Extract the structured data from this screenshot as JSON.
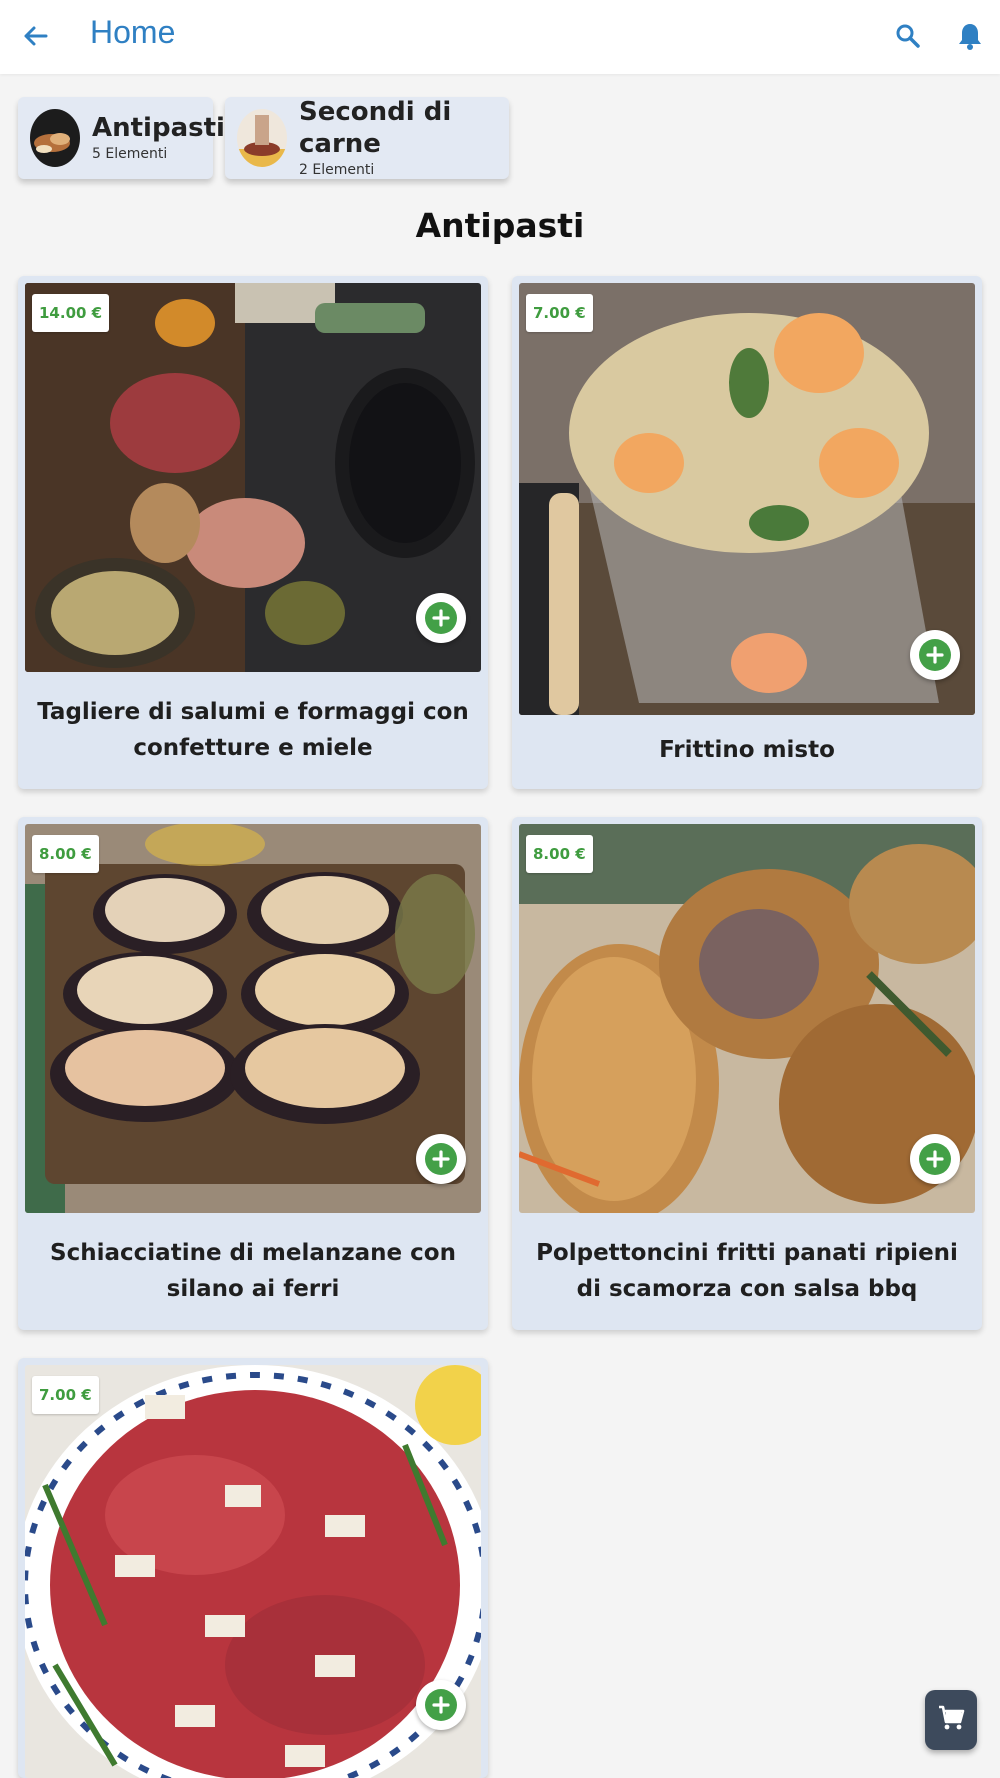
{
  "appbar": {
    "title": "Home",
    "back_icon": "arrow-left-icon",
    "search_icon": "search-icon",
    "notification_icon": "bell-icon"
  },
  "categories": [
    {
      "name": "Antipasti",
      "count": "5 Elementi"
    },
    {
      "name": "Secondi di carne",
      "count": "2 Elementi"
    }
  ],
  "section": {
    "title": "Antipasti"
  },
  "items": [
    {
      "price": "14.00 €",
      "name": "Tagliere di salumi e formaggi con confetture e miele"
    },
    {
      "price": "7.00 €",
      "name": "Frittino misto"
    },
    {
      "price": "8.00 €",
      "name": "Schiacciatine di melanzane con silano ai ferri"
    },
    {
      "price": "8.00 €",
      "name": "Polpettoncini fritti panati ripieni di scamorza con salsa bbq"
    },
    {
      "price": "7.00 €",
      "name": ""
    }
  ],
  "cart": {
    "icon": "cart-icon"
  },
  "colors": {
    "accent": "#2f80c3",
    "card_bg": "#dee6f2",
    "price_green": "#3f9c3f",
    "add_green": "#43a047",
    "cart_bg": "#3d4a5c"
  }
}
